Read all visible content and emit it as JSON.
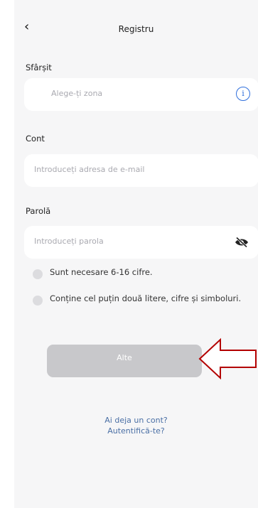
{
  "header": {
    "title": "Registru"
  },
  "zone": {
    "label": "Sfârșit",
    "placeholder": "Alege-ți zona"
  },
  "account": {
    "label": "Cont",
    "placeholder": "Introduceți adresa de e-mail"
  },
  "password": {
    "label": "Parolă",
    "placeholder": "Introduceți parola"
  },
  "rules": [
    "Sunt necesare 6-16 cifre.",
    "Conține cel puțin două litere, cifre și simboluri."
  ],
  "next_label": "Alte",
  "login_link": {
    "line1": "Ai deja un cont?",
    "line2": "Autentifică-te?"
  },
  "colors": {
    "accent": "#2f6fdc",
    "annotation_arrow": "#b30000",
    "disabled_button": "#c8c8cb"
  },
  "icons": {
    "back": "chevron-left-icon",
    "info": "info-icon",
    "eye": "eye-hidden-icon"
  }
}
